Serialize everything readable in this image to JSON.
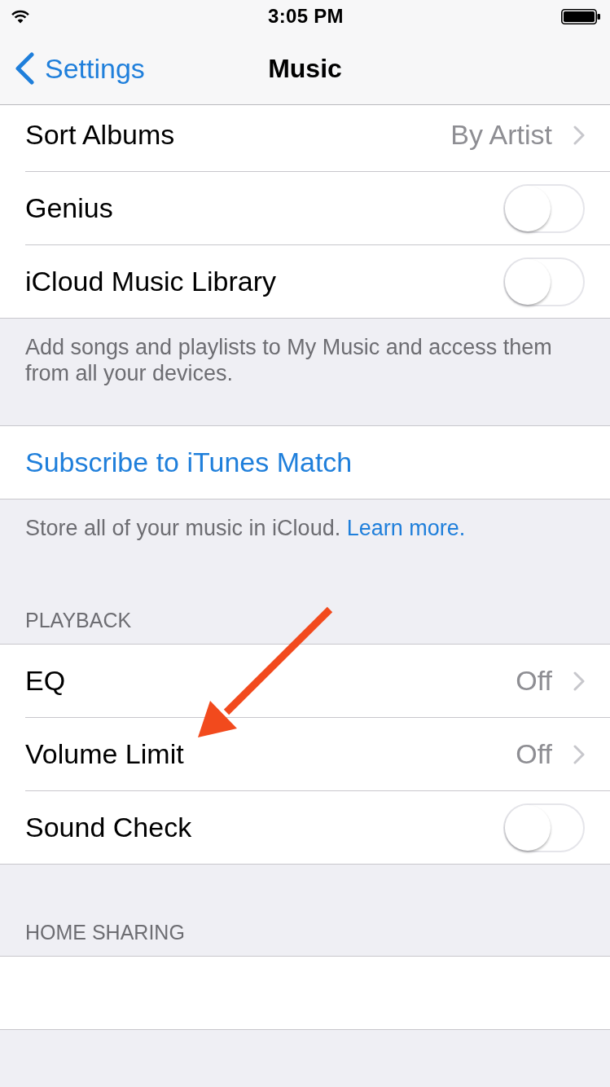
{
  "status_bar": {
    "time": "3:05 PM"
  },
  "nav_bar": {
    "back": "Settings",
    "title": "Music"
  },
  "sections": [
    {
      "rows": [
        {
          "kind": "value",
          "label": "Sort Albums",
          "value": "By Artist"
        },
        {
          "kind": "toggle",
          "label": "Genius",
          "on": false
        },
        {
          "kind": "toggle",
          "label": "iCloud Music Library",
          "on": false
        }
      ],
      "footer": {
        "text": "Add songs and playlists to My Music and access them from all your devices."
      }
    },
    {
      "rows": [
        {
          "kind": "link",
          "label": "Subscribe to iTunes Match"
        }
      ],
      "footer": {
        "text": "Store all of your music in iCloud.",
        "link": "Learn more."
      }
    },
    {
      "header": "PLAYBACK",
      "rows": [
        {
          "kind": "value",
          "label": "EQ",
          "value": "Off"
        },
        {
          "kind": "value",
          "label": "Volume Limit",
          "value": "Off"
        },
        {
          "kind": "toggle",
          "label": "Sound Check",
          "on": false
        }
      ]
    },
    {
      "header": "HOME SHARING",
      "rows": [
        {
          "kind": "blank"
        }
      ]
    }
  ]
}
